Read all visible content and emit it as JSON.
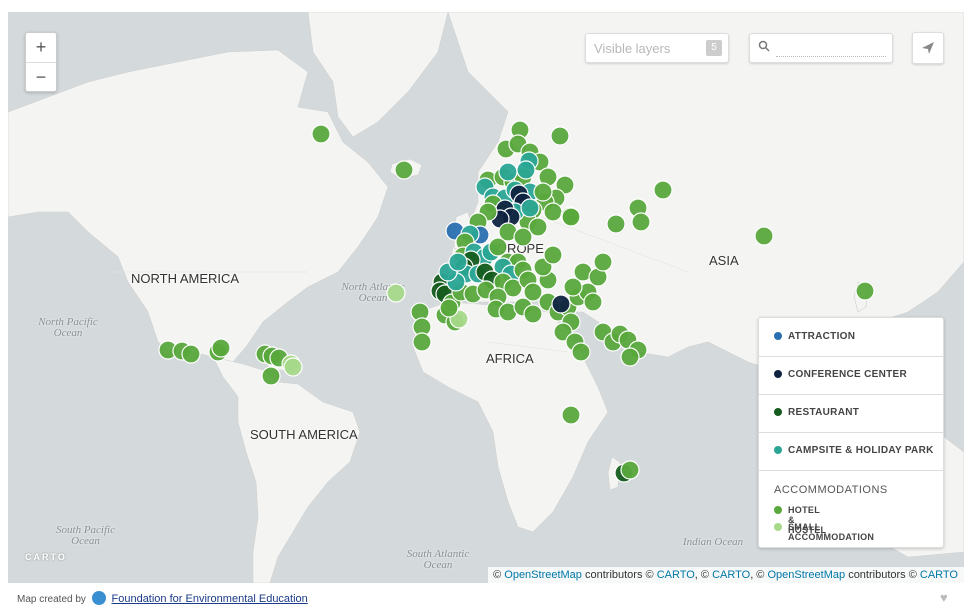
{
  "zoom": {
    "in_label": "+",
    "out_label": "−"
  },
  "visible_layers": {
    "label": "Visible layers",
    "count": "5"
  },
  "search": {
    "placeholder": ""
  },
  "continents": [
    "NORTH AMERICA",
    "SOUTH AMERICA",
    "EUROPE",
    "AFRICA",
    "ASIA"
  ],
  "oceans": [
    "North Pacific Ocean",
    "North Atlantic Ocean",
    "South Pacific Ocean",
    "South Atlantic Ocean",
    "Indian Ocean"
  ],
  "legend": {
    "items": [
      {
        "label": "ATTRACTION",
        "color": "#2a6fb0"
      },
      {
        "label": "CONFERENCE CENTER",
        "color": "#0f2340"
      },
      {
        "label": "RESTAURANT",
        "color": "#155c1e"
      },
      {
        "label": "CAMPSITE & HOLIDAY PARK",
        "color": "#2aa595"
      }
    ],
    "group_title": "ACCOMMODATIONS",
    "sub_items": [
      {
        "label": "HOTEL & HOSTEL",
        "color": "#58a83c"
      },
      {
        "label": "SMALL ACCOMMODATION",
        "color": "#a6d98a"
      }
    ]
  },
  "carto_logo": "CARTO",
  "attribution": {
    "prefix": "©",
    "osm": "OpenStreetMap",
    "contributors": "contributors ©",
    "carto": "CARTO",
    "sep": ", ©",
    "sep2": ", ©",
    "osm2": "OpenStreetMap",
    "contributors2": "contributors ©",
    "carto2": "CARTO",
    "carto3": "CARTO"
  },
  "footer": {
    "prefix": "Map created by",
    "org": "Foundation for Environmental Education"
  }
}
